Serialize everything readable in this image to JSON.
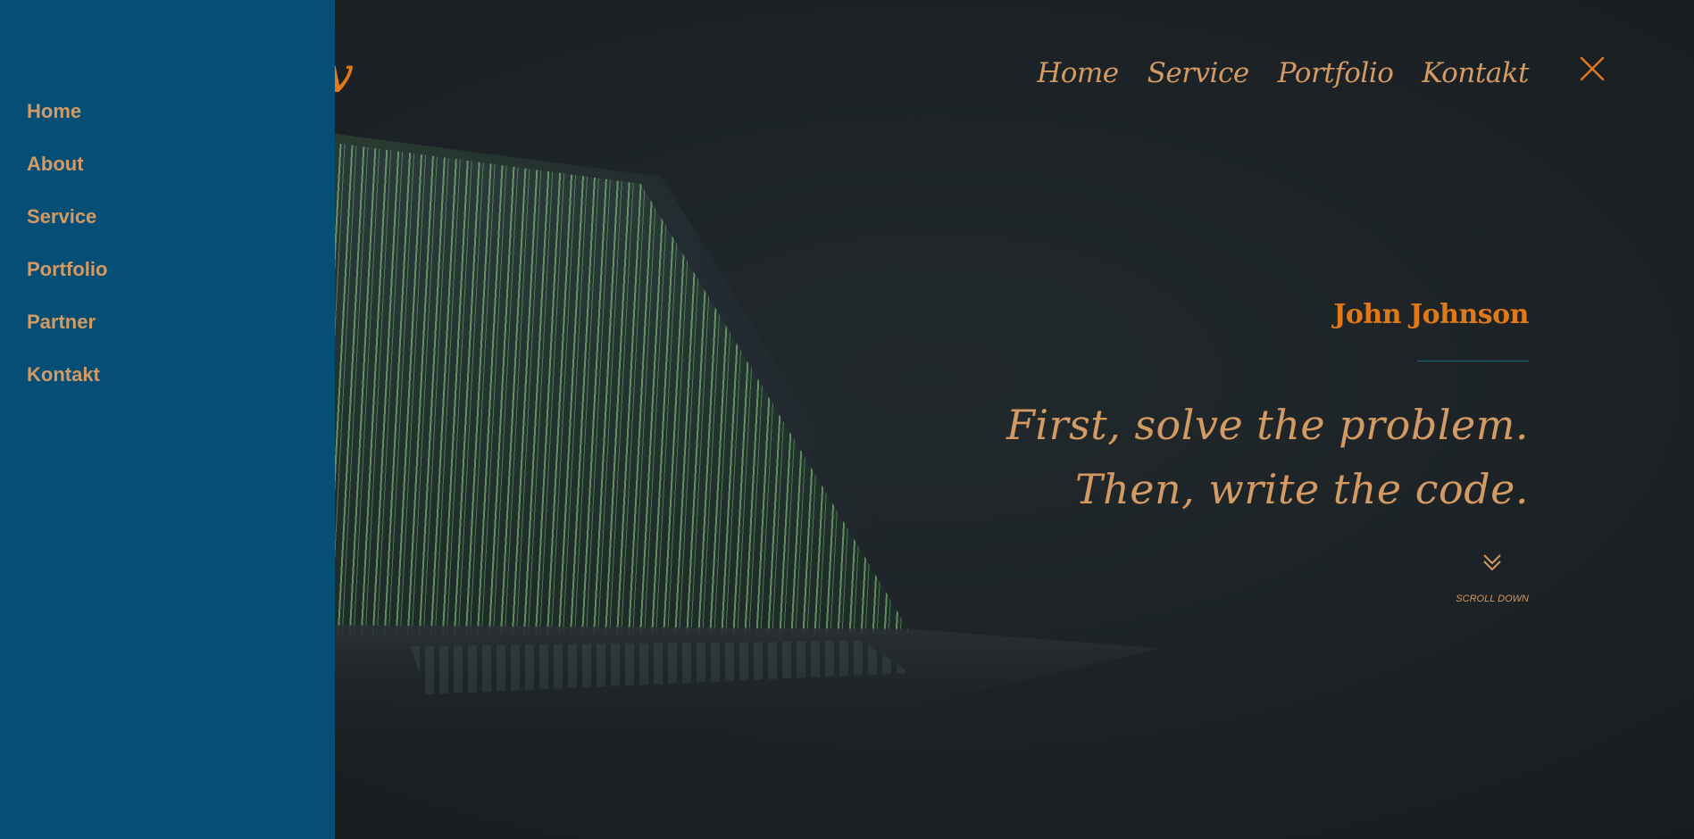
{
  "sidebar": {
    "items": [
      {
        "label": "Home"
      },
      {
        "label": "About"
      },
      {
        "label": "Service"
      },
      {
        "label": "Portfolio"
      },
      {
        "label": "Partner"
      },
      {
        "label": "Kontakt"
      }
    ]
  },
  "logo": {
    "text": "v"
  },
  "topnav": {
    "items": [
      {
        "label": "Home"
      },
      {
        "label": "Service"
      },
      {
        "label": "Portfolio"
      },
      {
        "label": "Kontakt"
      }
    ],
    "close_icon": "close-icon"
  },
  "hero": {
    "name": "John Johnson",
    "quote_line1": "First, solve the problem.",
    "quote_line2": "Then, write the code.",
    "scroll_icon": "double-chevron-down-icon",
    "scroll_label": "SCROLL DOWN"
  },
  "colors": {
    "sidebar_bg": "#054e76",
    "accent_orange": "#e07a18",
    "text_tan": "#d39a63",
    "divider": "#1a6a86",
    "background": "#1d2226"
  }
}
